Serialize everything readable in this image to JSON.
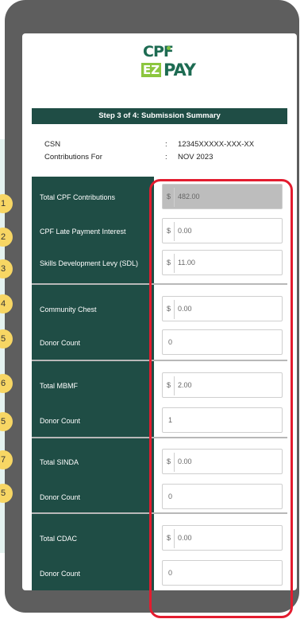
{
  "header": {
    "logo_top": "CPF",
    "logo_ez": "EZ",
    "logo_pay": "PAY",
    "step_title": "Step 3 of 4: Submission Summary"
  },
  "summary": {
    "csn_label": "CSN",
    "csn_value": "12345XXXXX-XXX-XX",
    "contrib_label": "Contributions For",
    "contrib_value": "NOV 2023",
    "colon": ":"
  },
  "fields": {
    "currency": "$",
    "total_cpf": {
      "label": "Total CPF Contributions",
      "value": "482.00",
      "marker": "1"
    },
    "late_interest": {
      "label": "CPF Late Payment Interest",
      "value": "0.00",
      "marker": "2"
    },
    "sdl": {
      "label": "Skills Development Levy (SDL)",
      "value": "11.00",
      "marker": "3"
    },
    "community_chest": {
      "label": "Community Chest",
      "value": "0.00",
      "marker": "4"
    },
    "cc_donor": {
      "label": "Donor Count",
      "value": "0",
      "marker": "5"
    },
    "mbmf": {
      "label": "Total MBMF",
      "value": "2.00",
      "marker": "6"
    },
    "mbmf_donor": {
      "label": "Donor Count",
      "value": "1",
      "marker": "5"
    },
    "sinda": {
      "label": "Total SINDA",
      "value": "0.00",
      "marker": "7"
    },
    "sinda_donor": {
      "label": "Donor Count",
      "value": "0",
      "marker": "5"
    },
    "cdac": {
      "label": "Total CDAC",
      "value": "0.00"
    },
    "cdac_donor": {
      "label": "Donor Count",
      "value": "0"
    }
  },
  "colors": {
    "panel": "#1f4d45",
    "marker": "#f7d664",
    "highlight": "#e31c2f",
    "phone": "#5e5e5e"
  }
}
